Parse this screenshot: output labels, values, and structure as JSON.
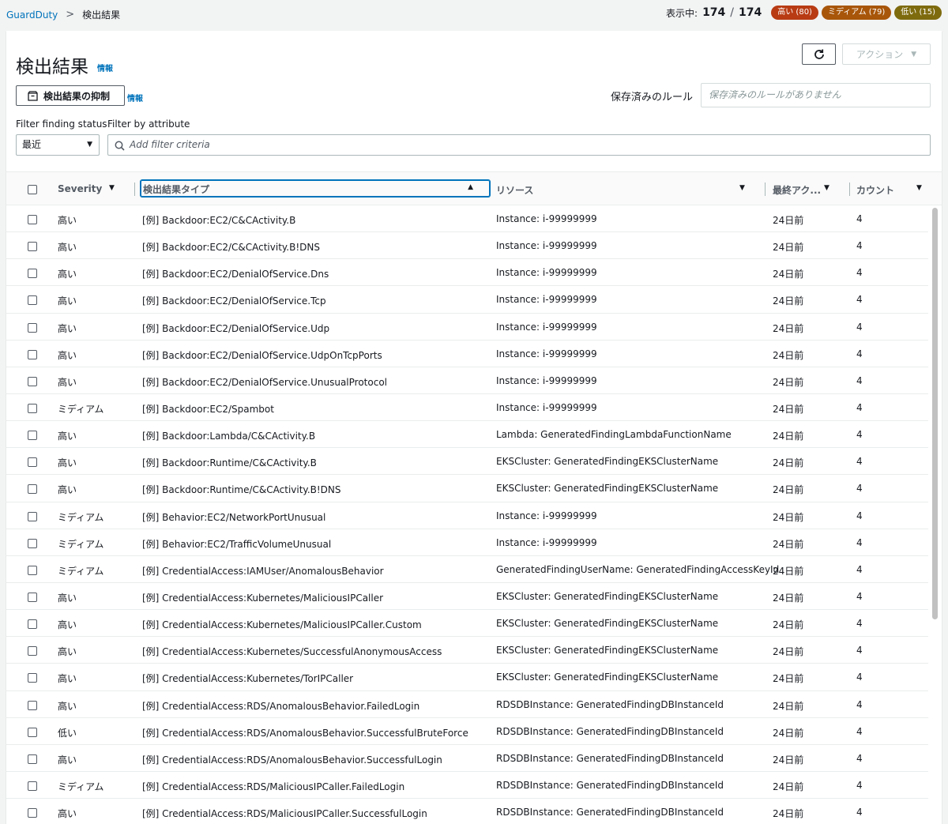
{
  "breadcrumb": {
    "root": "GuardDuty",
    "separator": ">",
    "current": "検出結果"
  },
  "stats": {
    "showing_label": "表示中:",
    "shown": "174",
    "total": "174",
    "high": "高い (80)",
    "medium": "ミディアム (79)",
    "low": "低い (15)",
    "colors": {
      "high": "#b83b13",
      "medium": "#a8560a",
      "low": "#7e6b0e"
    }
  },
  "page": {
    "title": "検出結果",
    "info": "情報",
    "refresh_icon": "refresh-icon",
    "actions_label": "アクション",
    "suppress_label": "検出結果の抑制",
    "suppress_info": "情報",
    "saved_rules_label": "保存済みのルール",
    "saved_rules_placeholder": "保存済みのルールがありません"
  },
  "filters": {
    "status_label": "Filter finding status",
    "attribute_label": "Filter by attribute",
    "status_value": "最近",
    "attribute_placeholder": "Add filter criteria"
  },
  "table": {
    "columns": {
      "severity": "Severity",
      "type": "検出結果タイプ",
      "resource": "リソース",
      "last_seen": "最終アク...",
      "count": "カウント"
    },
    "rows": [
      {
        "severity": "高い",
        "type": "[例] Backdoor:EC2/C&CActivity.B",
        "resource": "Instance: i-99999999",
        "last_seen": "24日前",
        "count": "4"
      },
      {
        "severity": "高い",
        "type": "[例] Backdoor:EC2/C&CActivity.B!DNS",
        "resource": "Instance: i-99999999",
        "last_seen": "24日前",
        "count": "4"
      },
      {
        "severity": "高い",
        "type": "[例] Backdoor:EC2/DenialOfService.Dns",
        "resource": "Instance: i-99999999",
        "last_seen": "24日前",
        "count": "4"
      },
      {
        "severity": "高い",
        "type": "[例] Backdoor:EC2/DenialOfService.Tcp",
        "resource": "Instance: i-99999999",
        "last_seen": "24日前",
        "count": "4"
      },
      {
        "severity": "高い",
        "type": "[例] Backdoor:EC2/DenialOfService.Udp",
        "resource": "Instance: i-99999999",
        "last_seen": "24日前",
        "count": "4"
      },
      {
        "severity": "高い",
        "type": "[例] Backdoor:EC2/DenialOfService.UdpOnTcpPorts",
        "resource": "Instance: i-99999999",
        "last_seen": "24日前",
        "count": "4"
      },
      {
        "severity": "高い",
        "type": "[例] Backdoor:EC2/DenialOfService.UnusualProtocol",
        "resource": "Instance: i-99999999",
        "last_seen": "24日前",
        "count": "4"
      },
      {
        "severity": "ミディアム",
        "type": "[例] Backdoor:EC2/Spambot",
        "resource": "Instance: i-99999999",
        "last_seen": "24日前",
        "count": "4"
      },
      {
        "severity": "高い",
        "type": "[例] Backdoor:Lambda/C&CActivity.B",
        "resource": "Lambda: GeneratedFindingLambdaFunctionName",
        "last_seen": "24日前",
        "count": "4"
      },
      {
        "severity": "高い",
        "type": "[例] Backdoor:Runtime/C&CActivity.B",
        "resource": "EKSCluster: GeneratedFindingEKSClusterName",
        "last_seen": "24日前",
        "count": "4"
      },
      {
        "severity": "高い",
        "type": "[例] Backdoor:Runtime/C&CActivity.B!DNS",
        "resource": "EKSCluster: GeneratedFindingEKSClusterName",
        "last_seen": "24日前",
        "count": "4"
      },
      {
        "severity": "ミディアム",
        "type": "[例] Behavior:EC2/NetworkPortUnusual",
        "resource": "Instance: i-99999999",
        "last_seen": "24日前",
        "count": "4"
      },
      {
        "severity": "ミディアム",
        "type": "[例] Behavior:EC2/TrafficVolumeUnusual",
        "resource": "Instance: i-99999999",
        "last_seen": "24日前",
        "count": "4"
      },
      {
        "severity": "ミディアム",
        "type": "[例] CredentialAccess:IAMUser/AnomalousBehavior",
        "resource": "GeneratedFindingUserName: GeneratedFindingAccessKeyId",
        "last_seen": "24日前",
        "count": "4"
      },
      {
        "severity": "高い",
        "type": "[例] CredentialAccess:Kubernetes/MaliciousIPCaller",
        "resource": "EKSCluster: GeneratedFindingEKSClusterName",
        "last_seen": "24日前",
        "count": "4"
      },
      {
        "severity": "高い",
        "type": "[例] CredentialAccess:Kubernetes/MaliciousIPCaller.Custom",
        "resource": "EKSCluster: GeneratedFindingEKSClusterName",
        "last_seen": "24日前",
        "count": "4"
      },
      {
        "severity": "高い",
        "type": "[例] CredentialAccess:Kubernetes/SuccessfulAnonymousAccess",
        "resource": "EKSCluster: GeneratedFindingEKSClusterName",
        "last_seen": "24日前",
        "count": "4"
      },
      {
        "severity": "高い",
        "type": "[例] CredentialAccess:Kubernetes/TorIPCaller",
        "resource": "EKSCluster: GeneratedFindingEKSClusterName",
        "last_seen": "24日前",
        "count": "4"
      },
      {
        "severity": "高い",
        "type": "[例] CredentialAccess:RDS/AnomalousBehavior.FailedLogin",
        "resource": "RDSDBInstance: GeneratedFindingDBInstanceId",
        "last_seen": "24日前",
        "count": "4"
      },
      {
        "severity": "低い",
        "type": "[例] CredentialAccess:RDS/AnomalousBehavior.SuccessfulBruteForce",
        "resource": "RDSDBInstance: GeneratedFindingDBInstanceId",
        "last_seen": "24日前",
        "count": "4"
      },
      {
        "severity": "高い",
        "type": "[例] CredentialAccess:RDS/AnomalousBehavior.SuccessfulLogin",
        "resource": "RDSDBInstance: GeneratedFindingDBInstanceId",
        "last_seen": "24日前",
        "count": "4"
      },
      {
        "severity": "ミディアム",
        "type": "[例] CredentialAccess:RDS/MaliciousIPCaller.FailedLogin",
        "resource": "RDSDBInstance: GeneratedFindingDBInstanceId",
        "last_seen": "24日前",
        "count": "4"
      },
      {
        "severity": "高い",
        "type": "[例] CredentialAccess:RDS/MaliciousIPCaller.SuccessfulLogin",
        "resource": "RDSDBInstance: GeneratedFindingDBInstanceId",
        "last_seen": "24日前",
        "count": "4"
      }
    ]
  }
}
